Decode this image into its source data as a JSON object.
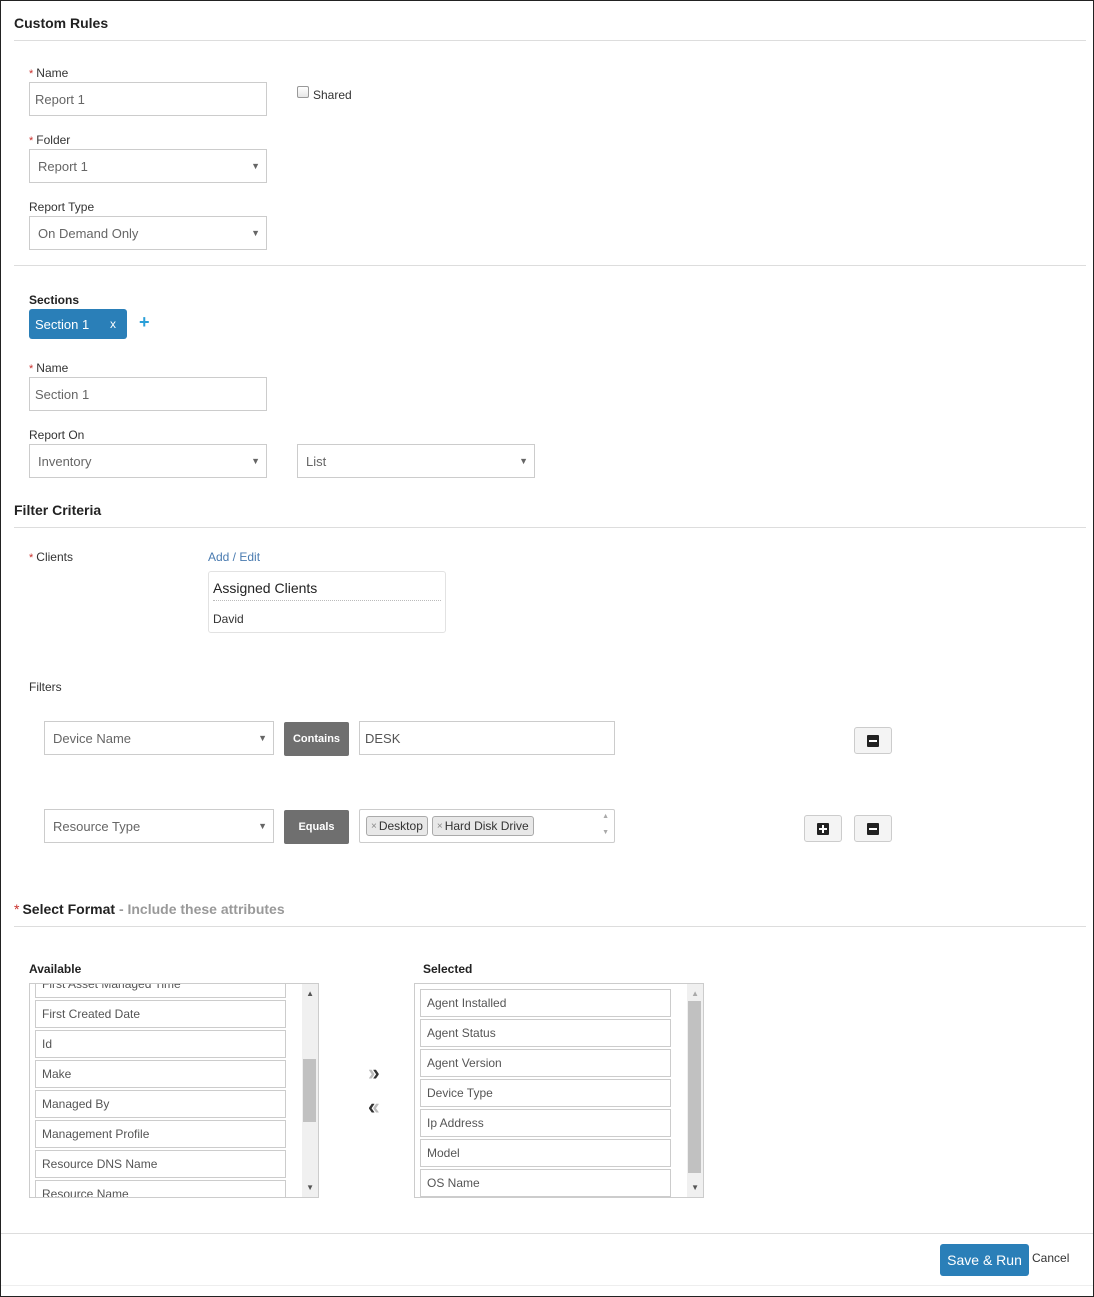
{
  "header": {
    "title": "Custom Rules"
  },
  "report": {
    "name_label": "Name",
    "name_value": "Report 1",
    "shared_label": "Shared",
    "shared_checked": false,
    "folder_label": "Folder",
    "folder_value": "Report 1",
    "report_type_label": "Report Type",
    "report_type_value": "On Demand Only"
  },
  "sections": {
    "label": "Sections",
    "tabs": [
      {
        "label": "Section 1",
        "close": "x"
      }
    ],
    "add_icon": "+",
    "name_label": "Name",
    "name_value": "Section 1",
    "report_on_label": "Report On",
    "report_on_value": "Inventory",
    "view_value": "List"
  },
  "filter_criteria": {
    "title": "Filter Criteria",
    "clients_label": "Clients",
    "add_edit_link": "Add / Edit",
    "assigned_title": "Assigned Clients",
    "assigned_clients": [
      "David"
    ],
    "filters_label": "Filters",
    "filters": [
      {
        "field": "Device Name",
        "operator": "Contains",
        "value": "DESK",
        "tags": []
      },
      {
        "field": "Resource Type",
        "operator": "Equals",
        "value": "",
        "tags": [
          "Desktop",
          "Hard Disk Drive"
        ]
      }
    ],
    "tag_remove_glyph": "×"
  },
  "select_format": {
    "title": "Select Format",
    "subtitle": "- Include these attributes",
    "available_label": "Available",
    "available_items": [
      "First Asset Managed Time",
      "First Created Date",
      "Id",
      "Make",
      "Managed By",
      "Management Profile",
      "Resource DNS Name",
      "Resource Name"
    ],
    "available_scroll_fraction": 0.45,
    "selected_label": "Selected",
    "selected_items": [
      "Agent Installed",
      "Agent Status",
      "Agent Version",
      "Device Type",
      "Ip Address",
      "Model",
      "OS Name"
    ],
    "move_right_glyph": "»",
    "move_left_glyph": "«"
  },
  "footer": {
    "save_run_label": "Save & Run",
    "cancel_label": "Cancel"
  },
  "colors": {
    "primary": "#2a7fb8",
    "required": "#c9302c",
    "operator": "#6f6f6f",
    "link": "#4a7bb0"
  }
}
